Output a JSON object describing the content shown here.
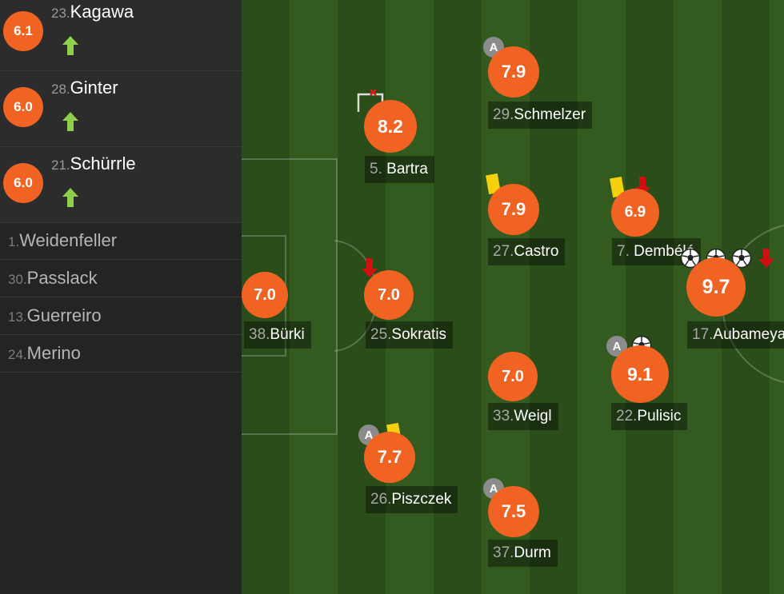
{
  "substitutes": [
    {
      "rating": "6.1",
      "number": "23.",
      "name": "Kagawa",
      "icon": "sub-on-arrow-icon"
    },
    {
      "rating": "6.0",
      "number": "28.",
      "name": "Ginter",
      "icon": "sub-on-arrow-icon"
    },
    {
      "rating": "6.0",
      "number": "21.",
      "name": "Schürrle",
      "icon": "sub-on-arrow-icon"
    }
  ],
  "bench": [
    {
      "number": "1.",
      "name": "Weidenfeller"
    },
    {
      "number": "30.",
      "name": "Passlack"
    },
    {
      "number": "13.",
      "name": "Guerreiro"
    },
    {
      "number": "24.",
      "name": "Merino"
    }
  ],
  "players": {
    "burki": {
      "rating": "7.0",
      "number": "38.",
      "name": "Bürki"
    },
    "bartra": {
      "rating": "8.2",
      "number": "5.",
      "name": "Bartra",
      "icon": "goal-frame-icon"
    },
    "sokratis": {
      "rating": "7.0",
      "number": "25.",
      "name": "Sokratis",
      "icon": "sub-off-arrow-icon"
    },
    "piszczek": {
      "rating": "7.7",
      "number": "26.",
      "name": "Piszczek",
      "badge": "A",
      "icon": "yellow-card-icon"
    },
    "schmelzer": {
      "rating": "7.9",
      "number": "29.",
      "name": "Schmelzer",
      "badge": "A"
    },
    "castro": {
      "rating": "7.9",
      "number": "27.",
      "name": "Castro",
      "icon": "yellow-card-icon"
    },
    "weigl": {
      "rating": "7.0",
      "number": "33.",
      "name": "Weigl"
    },
    "durm": {
      "rating": "7.5",
      "number": "37.",
      "name": "Durm",
      "badge": "A"
    },
    "dembele": {
      "rating": "6.9",
      "number": "7.",
      "name": "Dembélé",
      "icons": [
        "yellow-card-icon",
        "sub-off-arrow-icon"
      ]
    },
    "pulisic": {
      "rating": "9.1",
      "number": "22.",
      "name": "Pulisic",
      "badge": "A",
      "icon": "soccer-ball-icon"
    },
    "aubameyang": {
      "rating": "9.7",
      "number": "17.",
      "name": "Aubameyang",
      "icons": [
        "soccer-ball-icon",
        "soccer-ball-icon",
        "soccer-ball-icon",
        "sub-off-arrow-icon"
      ]
    }
  },
  "colors": {
    "rating": "#f06322",
    "yellow_card": "#f5d00c",
    "sub_on": "#8fcf4a",
    "sub_off": "#d01010",
    "pitch_dark": "#2a4d19",
    "pitch_light": "#335b1f"
  }
}
